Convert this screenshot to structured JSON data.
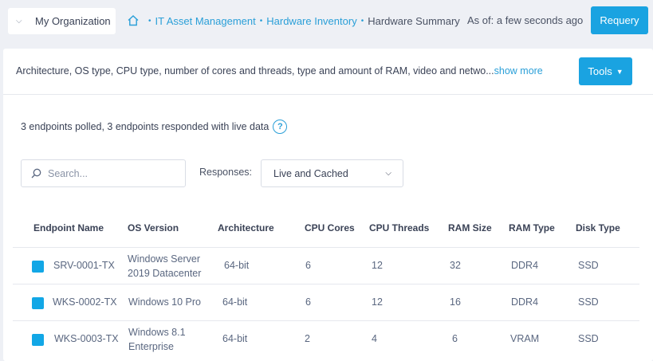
{
  "header": {
    "org_label": "My Organization",
    "breadcrumb": [
      "IT Asset Management",
      "Hardware Inventory"
    ],
    "current": "Hardware Summary",
    "as_of": "As of: a few seconds ago",
    "requery_label": "Requery"
  },
  "panel": {
    "description": "Architecture, OS type, CPU type, number of cores and threads, type and amount of RAM, video and netwo...",
    "show_more": "show more",
    "tools_label": "Tools",
    "status_text": "3 endpoints polled, 3 endpoints responded with live data",
    "help_glyph": "?",
    "search_placeholder": "Search...",
    "responses_label": "Responses:",
    "responses_value": "Live and Cached"
  },
  "table": {
    "columns": [
      "Endpoint Name",
      "OS Version",
      "Architecture",
      "CPU Cores",
      "CPU Threads",
      "RAM Size",
      "RAM Type",
      "Disk Type"
    ],
    "rows": [
      [
        "SRV-0001-TX",
        "Windows Server 2019 Datacenter",
        "64-bit",
        "6",
        "12",
        "32",
        "DDR4",
        "SSD"
      ],
      [
        "WKS-0002-TX",
        "Windows 10 Pro",
        "64-bit",
        "6",
        "12",
        "16",
        "DDR4",
        "SSD"
      ],
      [
        "WKS-0003-TX",
        "Windows 8.1 Enterprise",
        "64-bit",
        "2",
        "4",
        "6",
        "VRAM",
        "SSD"
      ]
    ]
  },
  "colors": {
    "accent": "#1aa3e1",
    "link": "#2a9fd8",
    "background": "#eef0f5"
  },
  "icons": [
    "chevron-down-icon",
    "home-icon",
    "caret-down-icon",
    "help-icon",
    "search-icon"
  ]
}
